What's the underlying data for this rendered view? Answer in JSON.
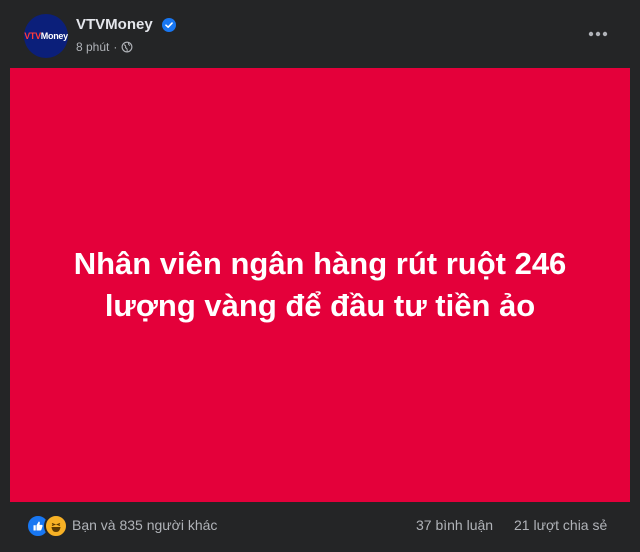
{
  "post": {
    "page_name": "VTVMoney",
    "avatar_text_mark": "VTV",
    "avatar_text_rest": "Money",
    "time": "8 phút",
    "separator": "·",
    "privacy_icon": "globe-icon",
    "verified_icon": "verified-badge-icon",
    "more_icon": "more-options-icon"
  },
  "banner": {
    "background": "#e4003a",
    "line1": "Nhân viên ngân hàng rút ruột 246",
    "line2": "lượng vàng để đầu tư tiền ảo"
  },
  "footer": {
    "reaction_icons": [
      "like-icon",
      "haha-icon"
    ],
    "reactions_text": "Bạn và 835 người khác",
    "comments_text": "37 bình luận",
    "shares_text": "21 lượt chia sẻ"
  },
  "colors": {
    "background": "#242526",
    "text_primary": "#e4e6eb",
    "text_secondary": "#b0b3b8",
    "accent_blue": "#1877f2"
  }
}
